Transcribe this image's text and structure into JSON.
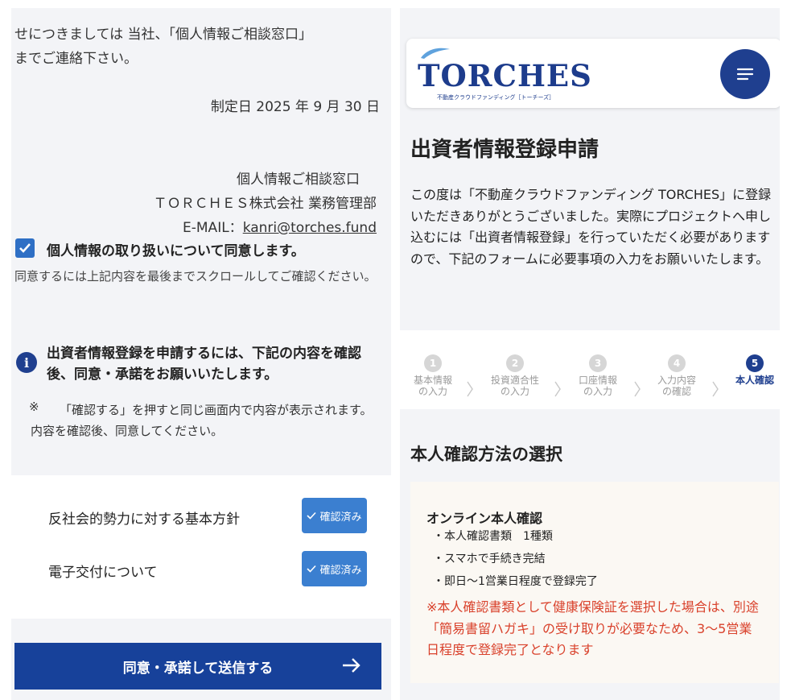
{
  "left": {
    "privacy_text": {
      "line1": "せにつきましては 当社、「個人情報ご相談窓口」",
      "line2": "までご連絡下さい。",
      "established": "制定日 2025 年 9 月 30 日",
      "contact_title": "個人情報ご相談窓口",
      "contact_company": "ＴＯＲＣＨＥＳ株式会社 業務管理部",
      "contact_email_label": "E-MAIL：",
      "contact_email": "kanri@torches.fund"
    },
    "consent": {
      "checked": true,
      "label": "個人情報の取り扱いについて同意します。",
      "note": "同意するには上記内容を最後までスクロールしてご確認ください。"
    },
    "info": {
      "icon": "info-icon",
      "title": "出資者情報登録を申請するには、下記の内容を確認後、同意・承諾をお願いいたします。",
      "note_mark": "※",
      "note": "「確認する」を押すと同じ画面内で内容が表示されます。内容を確認後、同意してください。"
    },
    "policies": [
      {
        "label": "反社会的勢力に対する基本方針",
        "button": "確認済み"
      },
      {
        "label": "電子交付について",
        "button": "確認済み"
      }
    ],
    "submit": {
      "label": "同意・承諾して送信する",
      "icon": "arrow-right-icon"
    },
    "colors": {
      "primary": "#17419a",
      "check": "#2e6fc5",
      "button": "#3b7fd0"
    }
  },
  "right": {
    "header": {
      "logo": "TORCHES",
      "logo_sub": "不動産クラウドファンディング［トーチーズ］",
      "menu_icon": "hamburger-icon"
    },
    "page_title": "出資者情報登録申請",
    "intro": "この度は「不動産クラウドファンディング TORCHES」に登録いただきありがとうございました。実際にプロジェクトへ申し込むには「出資者情報登録」を行っていただく必要がありますので、下記のフォームに必要事項の入力をお願いいたします。",
    "steps": [
      {
        "num": "1",
        "label1": "基本情報",
        "label2": "の入力",
        "active": false
      },
      {
        "num": "2",
        "label1": "投資適合性",
        "label2": "の入力",
        "active": false
      },
      {
        "num": "3",
        "label1": "口座情報",
        "label2": "の入力",
        "active": false
      },
      {
        "num": "4",
        "label1": "入力内容",
        "label2": "の確認",
        "active": false
      },
      {
        "num": "5",
        "label1": "本人確認",
        "label2": "",
        "active": true
      }
    ],
    "verify_section_title": "本人確認方法の選択",
    "verify_card": {
      "title": "オンライン本人確認",
      "items": [
        "・本人確認書類　1種類",
        "・スマホで手続き完結",
        "・即日〜1営業日程度で登録完了"
      ],
      "warning": "※本人確認書類として健康保険証を選択した場合は、別途「簡易書留ハガキ」の受け取りが必要なため、3〜5営業日程度で登録完了となります"
    },
    "colors": {
      "brand": "#1f3f8f",
      "warning": "#d9412b",
      "step_inactive": "#d6d6d6"
    }
  }
}
